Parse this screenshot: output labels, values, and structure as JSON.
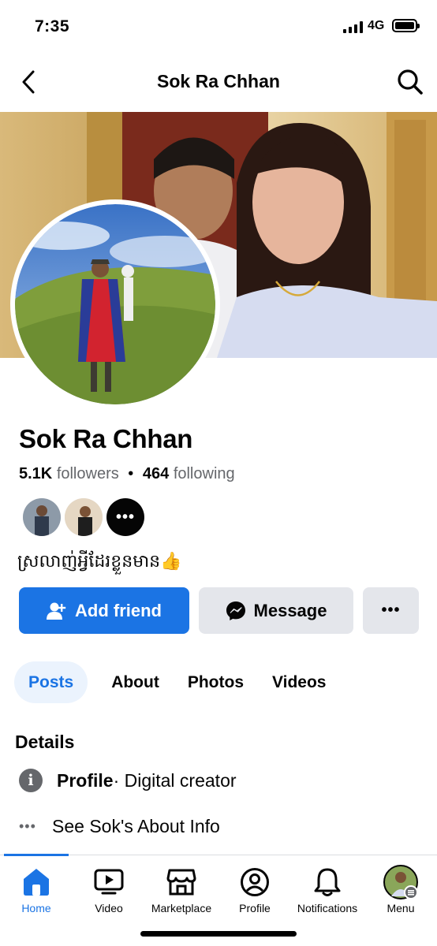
{
  "status_bar": {
    "time": "7:35",
    "network": "4G"
  },
  "header": {
    "title": "Sok Ra Chhan",
    "back_icon": "chevron-left-icon",
    "search_icon": "search-icon"
  },
  "profile": {
    "name": "Sok Ra Chhan",
    "followers_count": "5.1K",
    "followers_label": "followers",
    "separator": "•",
    "following_count": "464",
    "following_label": "following",
    "bio": "ស្រលាញ់អ្វីដែរខ្លួនមាន👍",
    "mutual_more": "•••"
  },
  "actions": {
    "add_friend": "Add friend",
    "message": "Message",
    "more": "•••"
  },
  "tabs": [
    "Posts",
    "About",
    "Photos",
    "Videos"
  ],
  "details": {
    "title": "Details",
    "profile_label": "Profile",
    "profile_value": " · Digital creator",
    "about_link": "See Sok's About Info",
    "about_dots": "•••"
  },
  "bottom_nav": [
    {
      "label": "Home",
      "icon": "home-icon",
      "active": true
    },
    {
      "label": "Video",
      "icon": "video-icon",
      "active": false
    },
    {
      "label": "Marketplace",
      "icon": "marketplace-icon",
      "active": false
    },
    {
      "label": "Profile",
      "icon": "profile-icon",
      "active": false
    },
    {
      "label": "Notifications",
      "icon": "bell-icon",
      "active": false
    },
    {
      "label": "Menu",
      "icon": "menu-avatar-icon",
      "active": false
    }
  ],
  "colors": {
    "accent": "#1b74e4",
    "button_gray": "#e4e6eb",
    "secondary_text": "#65676b"
  }
}
